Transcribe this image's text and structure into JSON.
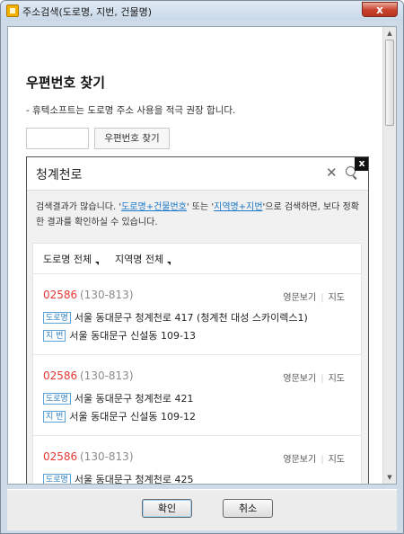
{
  "window": {
    "title": "주소검색(도로명, 지번, 건물명)",
    "close_label": "x"
  },
  "page": {
    "title": "우편번호 찾기",
    "notice": "- 휴텍소프트는 도로명 주소 사용을 적극 권장 합니다.",
    "postal_input_value": "",
    "find_button_label": "우편번호 찾기"
  },
  "popup": {
    "close_label": "x",
    "search_value": "청계천로",
    "clear_icon": "close-icon",
    "search_icon": "search-icon",
    "hint_part1": "검색결과가 많습니다. '",
    "hint_link1": "도로명+건물번호",
    "hint_part2": "' 또는 '",
    "hint_link2": "지역명+지번",
    "hint_part3": "'으로 검색하면, 보다 정확한 결과를 확인하실 수 있습니다.",
    "filters": [
      "도로명 전체",
      "지역명 전체"
    ],
    "action_labels": {
      "eng": "영문보기",
      "map": "지도"
    },
    "badges": {
      "road": "도로명",
      "jibun": "지 번"
    },
    "results": [
      {
        "zip": "02586",
        "old_zip": "(130-813)",
        "road": "서울 동대문구 청계천로 417 (청계천 대성 스카이렉스1)",
        "jibun": "서울 동대문구 신설동 109-13"
      },
      {
        "zip": "02586",
        "old_zip": "(130-813)",
        "road": "서울 동대문구 청계천로 421",
        "jibun": "서울 동대문구 신설동 109-12"
      },
      {
        "zip": "02586",
        "old_zip": "(130-813)",
        "road": "서울 동대문구 청계천로 425",
        "jibun": ""
      }
    ]
  },
  "buttons": {
    "ok": "확인",
    "cancel": "취소"
  },
  "colors": {
    "zip": "#e53935",
    "link": "#1a77c9",
    "badge": "#2f7fbf"
  }
}
